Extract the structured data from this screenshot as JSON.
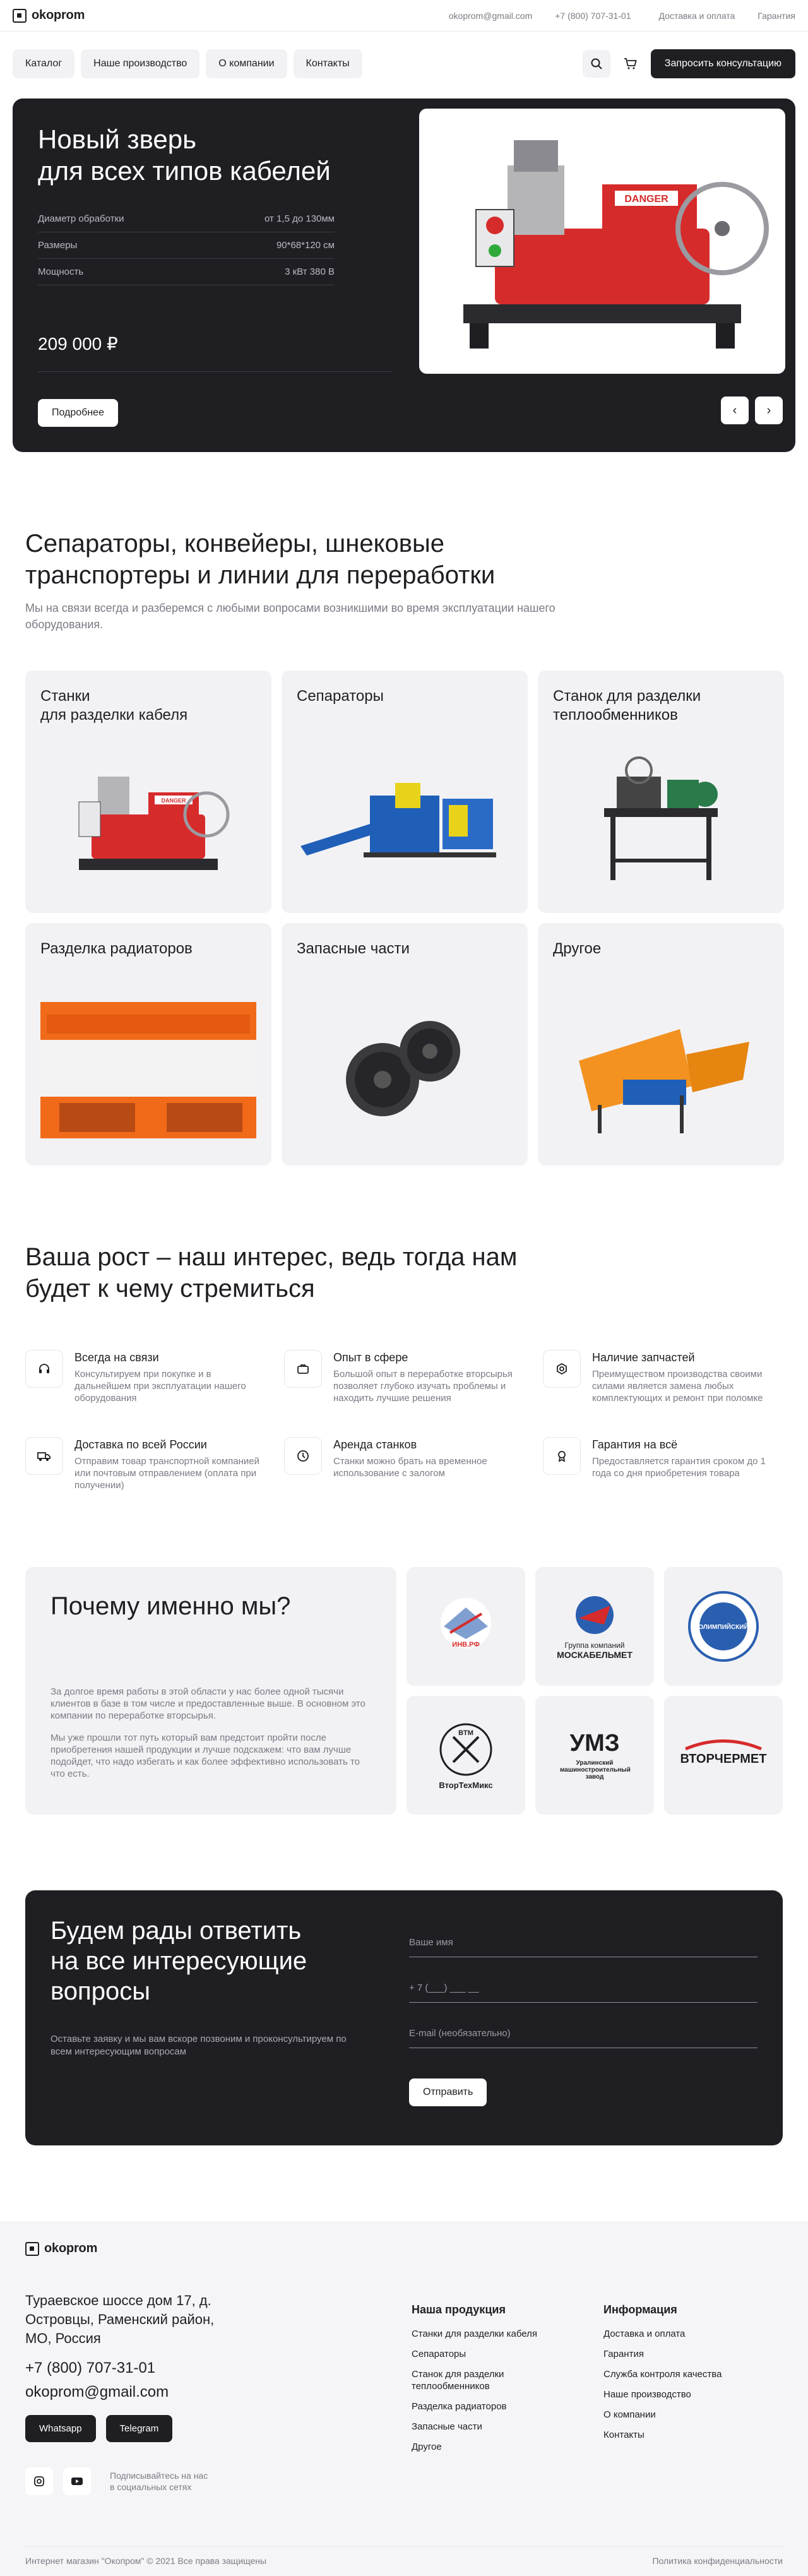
{
  "header": {
    "logo": "okoprom",
    "email": "okoprom@gmail.com",
    "phone": "+7 (800) 707-31-01",
    "links": [
      "Доставка и оплата",
      "Гарантия"
    ]
  },
  "nav": {
    "items": [
      "Каталог",
      "Наше производство",
      "О компании",
      "Контакты"
    ],
    "search_icon": "search-icon",
    "cart_icon": "cart-icon",
    "cta": "Запросить консультацию"
  },
  "hero": {
    "title": "Новый зверь\nдля всех типов кабелей",
    "specs": [
      {
        "label": "Диаметр обработки",
        "value": "от 1,5 до 130мм"
      },
      {
        "label": "Размеры",
        "value": "90*68*120 см"
      },
      {
        "label": "Мощность",
        "value": "3 кВт 380 В"
      }
    ],
    "price": "209 000 ₽",
    "more": "Подробнее",
    "image_text": "DANGER",
    "prev": "‹",
    "next": "›"
  },
  "categories": {
    "title": "Сепараторы, конвейеры, шнековые\nтранспортеры и линии для переработки",
    "subtitle": "Мы на связи всегда и разберемся с любыми вопросами возникшими во время эксплуатации нашего оборудования.",
    "items": [
      {
        "title": "Станки\nдля разделки кабеля",
        "image_text": "DANGER"
      },
      {
        "title": "Сепараторы"
      },
      {
        "title": "Станок для разделки\nтеплообменников"
      },
      {
        "title": "Разделка радиаторов"
      },
      {
        "title": "Запасные части"
      },
      {
        "title": "Другое"
      }
    ]
  },
  "features": {
    "title": "Ваша рост – наш интерес, ведь тогда нам\nбудет к чему стремиться",
    "items": [
      {
        "title": "Всегда на связи",
        "text": "Консультируем при покупке и в дальнейшем при эксплуатации нашего оборудования",
        "icon": "headset-icon"
      },
      {
        "title": "Опыт в сфере",
        "text": "Большой опыт в переработке вторсырья позволяет глубоко изучать проблемы и находить лучшие решения",
        "icon": "briefcase-icon"
      },
      {
        "title": "Наличие запчастей",
        "text": "Преимуществом производства своими силами является замена любых комплектующих и ремонт при поломке",
        "icon": "gear-icon"
      },
      {
        "title": "Доставка по всей России",
        "text": "Отправим товар транспортной компанией или почтовым отправлением (оплата при получении)",
        "icon": "truck-icon"
      },
      {
        "title": "Аренда станков",
        "text": "Станки можно брать на временное использование с залогом",
        "icon": "clock-icon"
      },
      {
        "title": "Гарантия на всё",
        "text": "Предоставляется гарантия сроком до 1 года со дня приобретения товара",
        "icon": "award-icon"
      }
    ]
  },
  "why": {
    "title": "Почему именно мы?",
    "p1": "За долгое время работы в этой области у нас более одной тысячи клиентов в базе в том числе и предоставленные выше. В основном это компании по переработке вторсырья.",
    "p2": "Мы уже прошли тот путь который вам предстоит пройти после приобретения нашей продукции и лучше подскажем: что вам лучше подойдет, что надо избегать и как более эффективно использовать то что есть.",
    "partners": [
      {
        "name": "ИНВ.РФ",
        "label": "",
        "sub": ""
      },
      {
        "name": "",
        "label": "Группа компаний",
        "sub": "МОСКАБЕЛЬМЕТ"
      },
      {
        "name": "ОЛИМПИЙСКИЙ",
        "label": "",
        "sub": ""
      },
      {
        "name": "BTM",
        "label": "",
        "sub": "ВторТехМикс"
      },
      {
        "name": "УМЗ",
        "label": "Уралинский машиностроительный завод",
        "sub": ""
      },
      {
        "name": "ВТОРЧЕРМЕТ",
        "label": "",
        "sub": ""
      }
    ]
  },
  "contact": {
    "title": "Будем рады ответить\nна все интересующие\nвопросы",
    "subtitle": "Оставьте заявку и мы вам вскоре позвоним и проконсультируем по всем интересующим вопросам",
    "name_placeholder": "Ваше имя",
    "phone_placeholder": "+ 7 (___) ___ __",
    "email_placeholder": "E-mail (необязательно)",
    "send": "Отправить"
  },
  "footer": {
    "logo": "okoprom",
    "address": "Тураевское шоссе дом 17, д.\nОстровцы, Раменский район,\nМО, Россия",
    "phone": "+7 (800) 707-31-01",
    "email": "okoprom@gmail.com",
    "whatsapp": "Whatsapp",
    "telegram": "Telegram",
    "social_text": "Подписывайтесь на нас\nв социальных сетях",
    "products_title": "Наша продукция",
    "products": [
      "Станки для разделки кабеля",
      "Сепараторы",
      "Станок для разделки теплообменников",
      "Разделка радиаторов",
      "Запасные части",
      "Другое"
    ],
    "info_title": "Информация",
    "info": [
      "Доставка и оплата",
      "Гарантия",
      "Служба контроля качества",
      "Наше производство",
      "О компании",
      "Контакты"
    ],
    "copyright": "Интернет магазин \"Окопром\" © 2021 Все права защищены",
    "privacy": "Политика конфиденциальности"
  },
  "colors": {
    "dark": "#1f1f23",
    "light_bg": "#f2f2f5",
    "muted": "#7a7a84",
    "red": "#d62b2b",
    "orange": "#f07a1a",
    "blue": "#1f5fb8"
  }
}
